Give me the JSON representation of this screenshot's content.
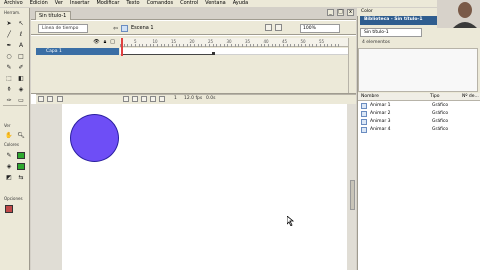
{
  "menu": [
    "Archivo",
    "Edición",
    "Ver",
    "Insertar",
    "Modificar",
    "Texto",
    "Comandos",
    "Control",
    "Ventana",
    "Ayuda"
  ],
  "tools": {
    "herramientas_label": "Herram.",
    "ver_label": "Ver",
    "colores_label": "Colores",
    "opciones_label": "Opciones"
  },
  "document": {
    "tab_title": "Sin título-1",
    "timeline_button": "Línea de tiempo",
    "scene_label": "Escena 1",
    "zoom": "100%",
    "window_controls": [
      "_",
      "□",
      "x"
    ]
  },
  "timeline": {
    "layer_name": "Capa 1",
    "ruler": [
      "5",
      "10",
      "15",
      "20",
      "25",
      "30",
      "35",
      "40",
      "45",
      "50",
      "55"
    ],
    "current_frame": "1",
    "fps": "12.0 fps",
    "elapsed": "0.0s"
  },
  "stage": {
    "circle_color": "#6e4ef6"
  },
  "library": {
    "color_header": "Color",
    "panel_title": "Biblioteca - Sin título-1",
    "selected_doc": "Sin título-1",
    "count": "4 elementos",
    "columns": [
      "Nombre",
      "Tipo",
      "Nº de..."
    ],
    "items": [
      {
        "name": "Animar 1",
        "type": "Gráfico"
      },
      {
        "name": "Animar 2",
        "type": "Gráfico"
      },
      {
        "name": "Animar 3",
        "type": "Gráfico"
      },
      {
        "name": "Animar 4",
        "type": "Gráfico"
      }
    ]
  }
}
